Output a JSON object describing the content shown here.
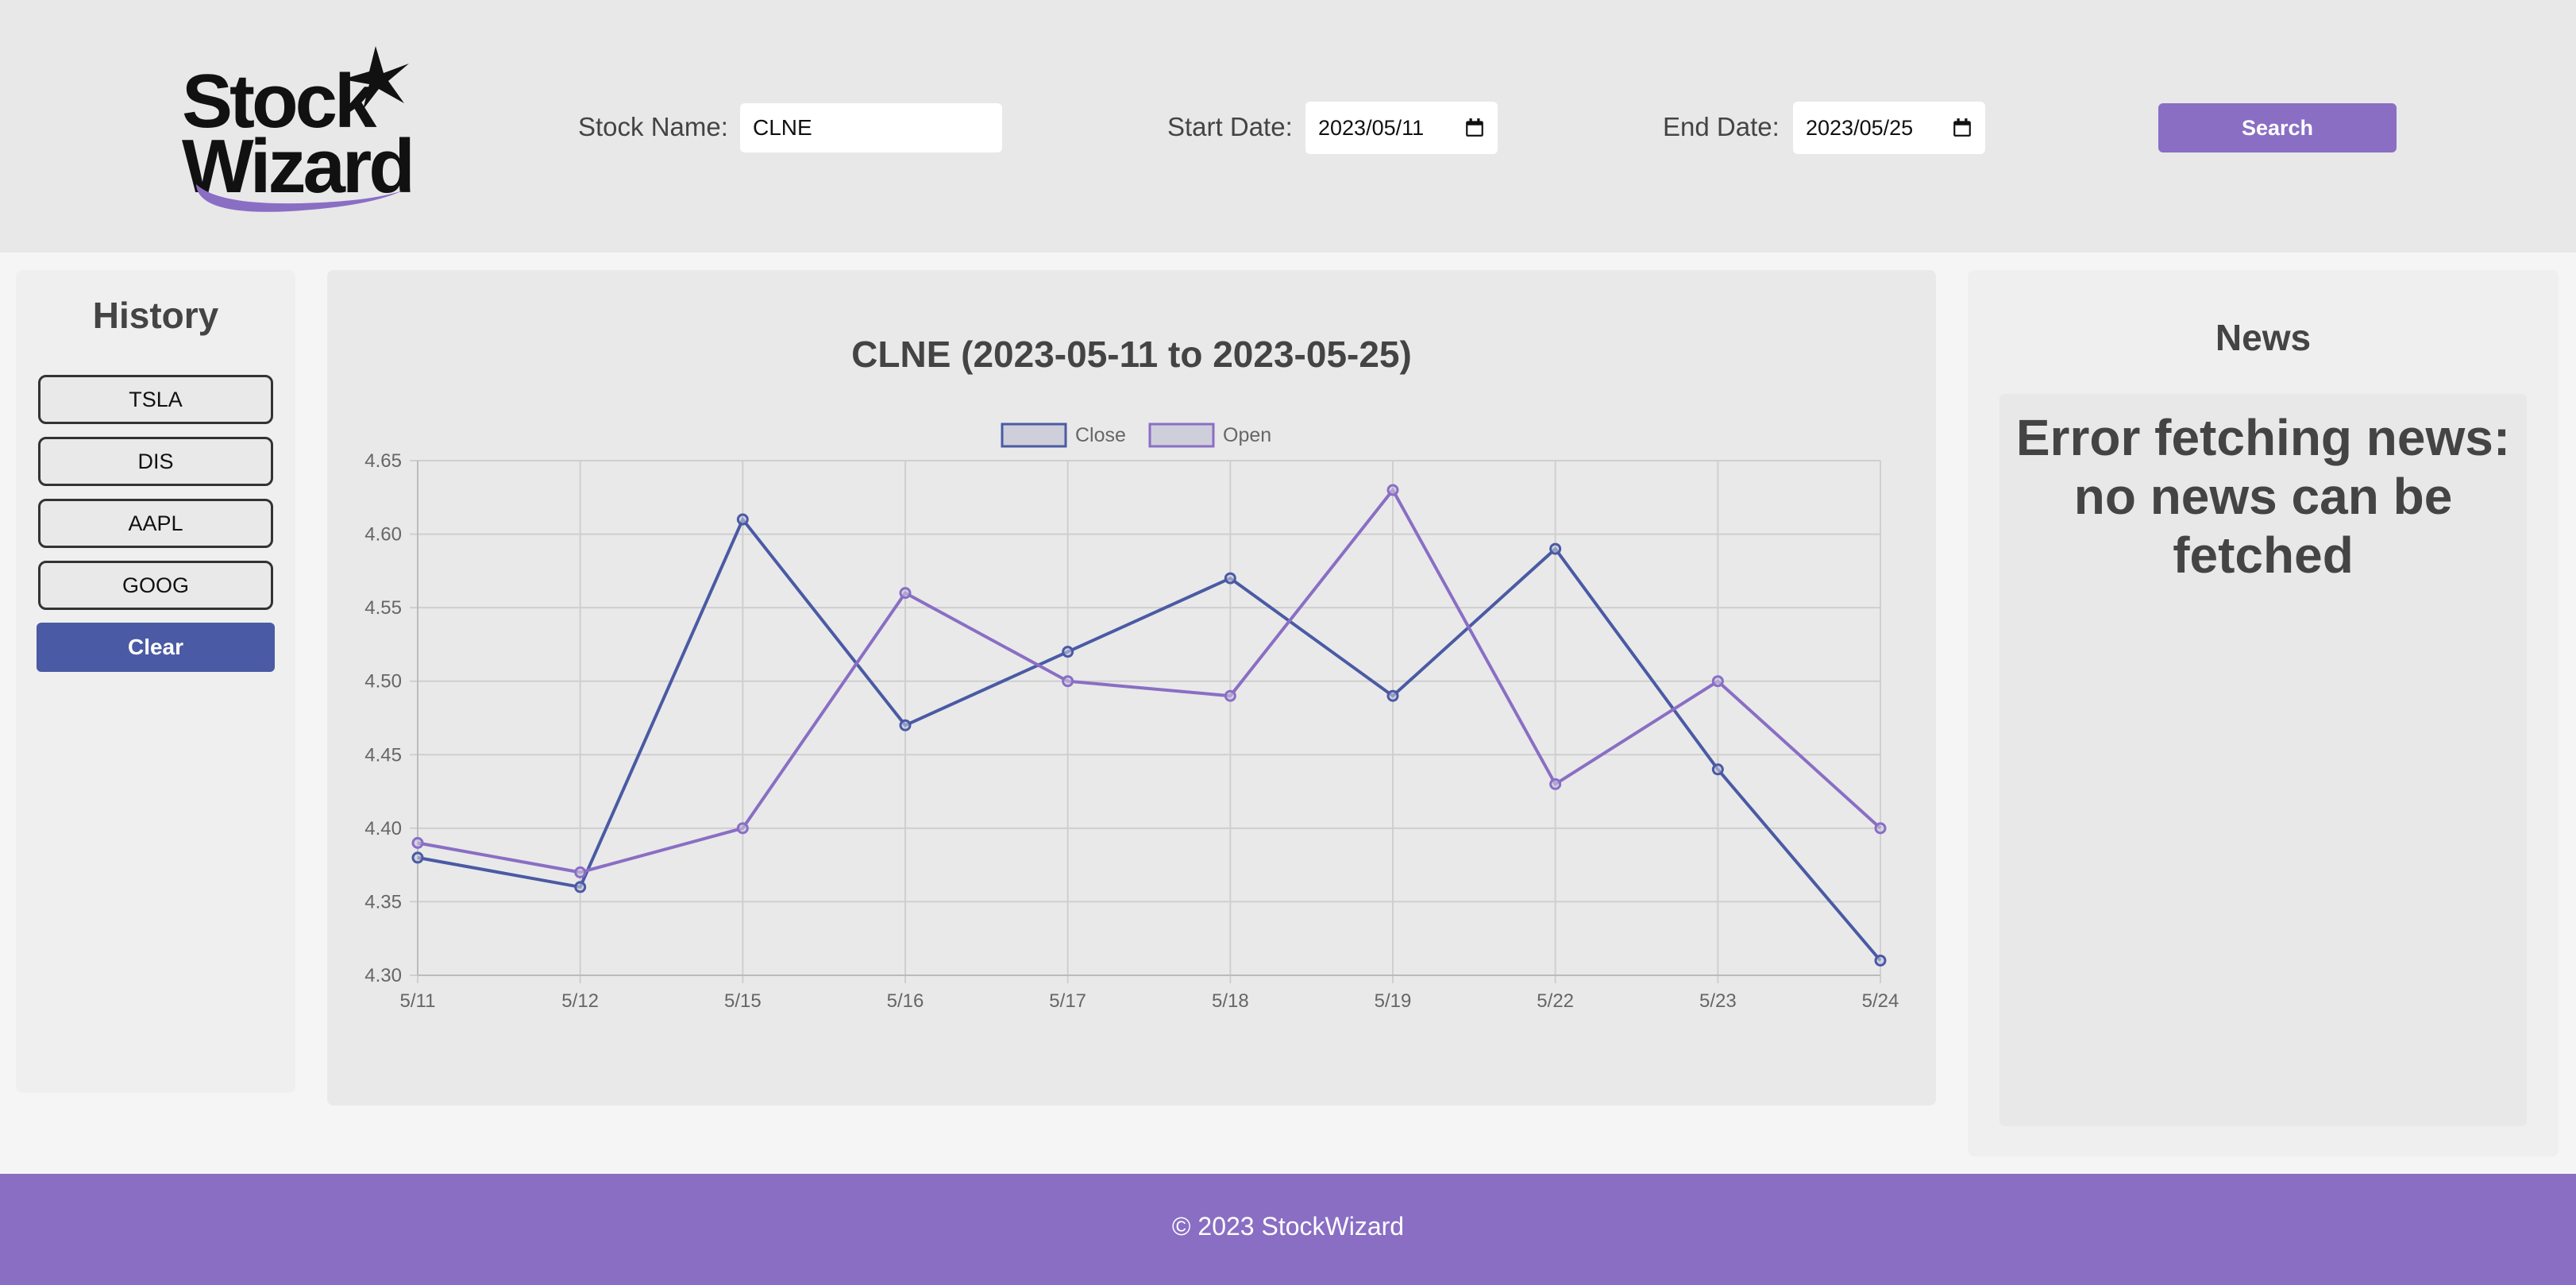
{
  "header": {
    "logo_line1": "Stock",
    "logo_line2": "Wizard",
    "stock_name_label": "Stock Name:",
    "stock_name_value": "CLNE",
    "start_date_label": "Start Date:",
    "start_date_value": "2023/05/11",
    "end_date_label": "End Date:",
    "end_date_value": "2023/05/25",
    "search_label": "Search"
  },
  "history": {
    "title": "History",
    "items": [
      "TSLA",
      "DIS",
      "AAPL",
      "GOOG"
    ],
    "clear_label": "Clear"
  },
  "news": {
    "title": "News",
    "message": "Error fetching news: no news can be fetched"
  },
  "footer": {
    "text": "© 2023 StockWizard"
  },
  "colors": {
    "accent": "#8a6ec4",
    "close_line": "#4a5aa4",
    "open_line": "#8a6ec4"
  },
  "chart_data": {
    "type": "line",
    "title": "CLNE (2023-05-11 to 2023-05-25)",
    "categories": [
      "5/11",
      "5/12",
      "5/15",
      "5/16",
      "5/17",
      "5/18",
      "5/19",
      "5/22",
      "5/23",
      "5/24"
    ],
    "series": [
      {
        "name": "Close",
        "color": "#4a5aa4",
        "values": [
          4.38,
          4.36,
          4.61,
          4.47,
          4.52,
          4.57,
          4.49,
          4.59,
          4.44,
          4.31
        ]
      },
      {
        "name": "Open",
        "color": "#8a6ec4",
        "values": [
          4.39,
          4.37,
          4.4,
          4.56,
          4.5,
          4.49,
          4.63,
          4.43,
          4.5,
          4.4
        ]
      }
    ],
    "ylim": [
      4.3,
      4.65
    ],
    "yticks": [
      "4.65",
      "4.60",
      "4.55",
      "4.50",
      "4.45",
      "4.40",
      "4.35",
      "4.30"
    ],
    "grid": true,
    "legend": "top"
  }
}
